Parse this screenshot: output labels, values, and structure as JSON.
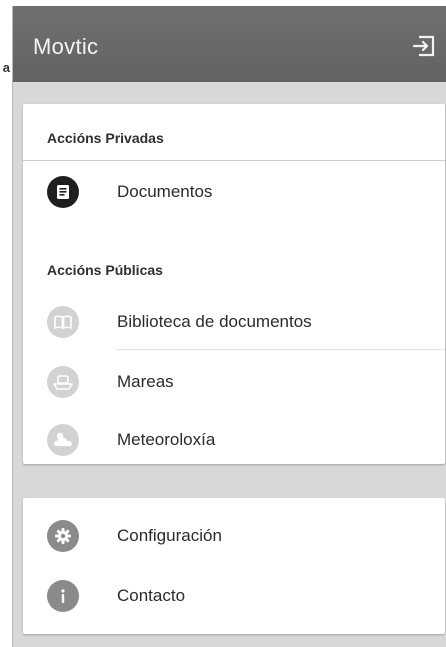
{
  "stray_char": "a",
  "header": {
    "title": "Movtic",
    "logout_icon": "logout-icon"
  },
  "private_section": {
    "title": "Accións Privadas",
    "items": [
      {
        "label": "Documentos",
        "icon": "document-icon",
        "color": "#1f1f1f"
      }
    ]
  },
  "public_section": {
    "title": "Accións Públicas",
    "items": [
      {
        "label": "Biblioteca de documentos",
        "icon": "library-book-icon",
        "color": "#d2d2d2"
      },
      {
        "label": "Mareas",
        "icon": "boat-icon",
        "color": "#d2d2d2"
      },
      {
        "label": "Meteoroloxía",
        "icon": "weather-cloud-icon",
        "color": "#d2d2d2"
      }
    ]
  },
  "settings_section": {
    "items": [
      {
        "label": "Configuración",
        "icon": "gear-icon",
        "color": "#8a8a8a"
      },
      {
        "label": "Contacto",
        "icon": "info-icon",
        "color": "#8a8a8a"
      }
    ]
  }
}
